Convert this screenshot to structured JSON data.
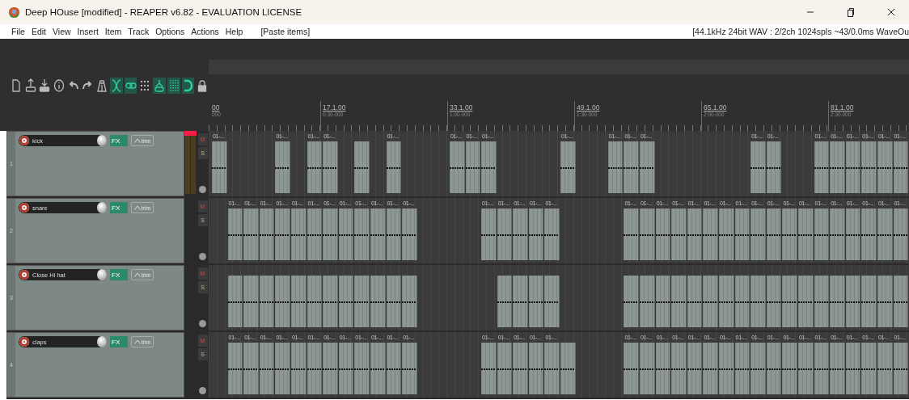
{
  "window": {
    "title": "Deep HOuse [modified] - REAPER v6.82 - EVALUATION LICENSE"
  },
  "menu": [
    {
      "label": "File"
    },
    {
      "label": "Edit"
    },
    {
      "label": "View"
    },
    {
      "label": "Insert"
    },
    {
      "label": "Item"
    },
    {
      "label": "Track"
    },
    {
      "label": "Options"
    },
    {
      "label": "Actions"
    },
    {
      "label": "Help"
    }
  ],
  "last_action": "[Paste items]",
  "audio_status": "[44.1kHz 24bit WAV : 2/2ch 1024spls ~43/0.0ms WaveOu",
  "toolbar": [
    {
      "kind": "new-file",
      "on": false
    },
    {
      "kind": "upload",
      "on": false
    },
    {
      "kind": "download",
      "on": false
    },
    {
      "kind": "info",
      "on": false
    },
    {
      "kind": "undo",
      "on": false
    },
    {
      "kind": "redo",
      "on": false
    },
    {
      "kind": "metronome",
      "on": false
    },
    {
      "kind": "crossfade",
      "on": true
    },
    {
      "kind": "link",
      "on": true
    },
    {
      "kind": "grid-dots",
      "on": false
    },
    {
      "kind": "group",
      "on": true
    },
    {
      "kind": "grid-lines",
      "on": true
    },
    {
      "kind": "magnet",
      "on": true
    },
    {
      "kind": "lock",
      "on": false
    }
  ],
  "ruler": [
    {
      "bar": "00",
      "time": "000"
    },
    {
      "bar": "17.1.00",
      "time": "0:30.000"
    },
    {
      "bar": "33.1.00",
      "time": "1:00.000"
    },
    {
      "bar": "49.1.00",
      "time": "1:30.000"
    },
    {
      "bar": "65.1.00",
      "time": "2:00.000"
    },
    {
      "bar": "81.1.00",
      "time": "2:30.000"
    }
  ],
  "tracks": [
    {
      "number": "1",
      "name": "kick",
      "fx": "FX",
      "trim": "trim",
      "mute": "M",
      "solo": "S",
      "peak": true,
      "items": [
        {
          "kind": "clip",
          "label": "01-..."
        },
        {
          "kind": "gap"
        },
        {
          "kind": "gap"
        },
        {
          "kind": "gap"
        },
        {
          "kind": "clip",
          "label": "01-..."
        },
        {
          "kind": "gap"
        },
        {
          "kind": "clip",
          "label": "01-..."
        },
        {
          "kind": "clip",
          "label": "01-..."
        },
        {
          "kind": "gap"
        },
        {
          "kind": "tail"
        },
        {
          "kind": "gap"
        },
        {
          "kind": "clip",
          "label": "01-..."
        },
        {
          "kind": "gap"
        },
        {
          "kind": "gap"
        },
        {
          "kind": "gap"
        },
        {
          "kind": "clip",
          "label": "01-..."
        },
        {
          "kind": "clip",
          "label": "01-..."
        },
        {
          "kind": "clip",
          "label": "01-..."
        },
        {
          "kind": "gap"
        },
        {
          "kind": "gap"
        },
        {
          "kind": "gap"
        },
        {
          "kind": "gap"
        },
        {
          "kind": "clip",
          "label": "01-..."
        },
        {
          "kind": "gap"
        },
        {
          "kind": "gap"
        },
        {
          "kind": "clip",
          "label": "01-..."
        },
        {
          "kind": "clip",
          "label": "01-..."
        },
        {
          "kind": "clip",
          "label": "01-..."
        },
        {
          "kind": "gap"
        },
        {
          "kind": "gap"
        },
        {
          "kind": "gap"
        },
        {
          "kind": "gap"
        },
        {
          "kind": "gap"
        },
        {
          "kind": "gap"
        },
        {
          "kind": "clip",
          "label": "01-..."
        },
        {
          "kind": "clip",
          "label": "01-..."
        },
        {
          "kind": "gap"
        },
        {
          "kind": "gap"
        },
        {
          "kind": "clip",
          "label": "01-..."
        },
        {
          "kind": "clip",
          "label": "01-..."
        },
        {
          "kind": "clip",
          "label": "01-..."
        },
        {
          "kind": "clip",
          "label": "01-..."
        },
        {
          "kind": "clip",
          "label": "01-..."
        },
        {
          "kind": "clip",
          "label": "01-..."
        }
      ]
    },
    {
      "number": "2",
      "name": "snare",
      "fx": "FX",
      "trim": "trim",
      "mute": "M",
      "solo": "S",
      "peak": false,
      "items": [
        {
          "kind": "gap"
        },
        {
          "kind": "clip",
          "label": "01-..."
        },
        {
          "kind": "clip",
          "label": "01-..."
        },
        {
          "kind": "clip",
          "label": "01-..."
        },
        {
          "kind": "clip",
          "label": "01-..."
        },
        {
          "kind": "clip",
          "label": "01-..."
        },
        {
          "kind": "clip",
          "label": "01-..."
        },
        {
          "kind": "clip",
          "label": "01-..."
        },
        {
          "kind": "clip",
          "label": "01-..."
        },
        {
          "kind": "clip",
          "label": "01-..."
        },
        {
          "kind": "clip",
          "label": "01-..."
        },
        {
          "kind": "clip",
          "label": "01-..."
        },
        {
          "kind": "clip",
          "label": "01-..."
        },
        {
          "kind": "gap"
        },
        {
          "kind": "gap"
        },
        {
          "kind": "gap"
        },
        {
          "kind": "gap"
        },
        {
          "kind": "clip",
          "label": "01-..."
        },
        {
          "kind": "clip",
          "label": "01-..."
        },
        {
          "kind": "clip",
          "label": "01-..."
        },
        {
          "kind": "clip",
          "label": "01-..."
        },
        {
          "kind": "clip",
          "label": "01-..."
        },
        {
          "kind": "gap"
        },
        {
          "kind": "gap"
        },
        {
          "kind": "gap"
        },
        {
          "kind": "gap"
        },
        {
          "kind": "clip",
          "label": "01-..."
        },
        {
          "kind": "clip",
          "label": "01-..."
        },
        {
          "kind": "clip",
          "label": "01-..."
        },
        {
          "kind": "clip",
          "label": "01-..."
        },
        {
          "kind": "clip",
          "label": "01-..."
        },
        {
          "kind": "clip",
          "label": "01-..."
        },
        {
          "kind": "clip",
          "label": "01-..."
        },
        {
          "kind": "clip",
          "label": "01-..."
        },
        {
          "kind": "clip",
          "label": "01-..."
        },
        {
          "kind": "clip",
          "label": "01-..."
        },
        {
          "kind": "clip",
          "label": "01-..."
        },
        {
          "kind": "clip",
          "label": "01-..."
        },
        {
          "kind": "clip",
          "label": "01-..."
        },
        {
          "kind": "clip",
          "label": "01-..."
        },
        {
          "kind": "clip",
          "label": "01-..."
        },
        {
          "kind": "clip",
          "label": "01-..."
        },
        {
          "kind": "clip",
          "label": "01-..."
        },
        {
          "kind": "clip",
          "label": "01-..."
        }
      ]
    },
    {
      "number": "3",
      "name": "Close Hi hat",
      "fx": "FX",
      "trim": "trim",
      "mute": "M",
      "solo": "S",
      "peak": false,
      "items": [
        {
          "kind": "gap"
        },
        {
          "kind": "tail"
        },
        {
          "kind": "tail"
        },
        {
          "kind": "tail"
        },
        {
          "kind": "tail"
        },
        {
          "kind": "tail"
        },
        {
          "kind": "tail"
        },
        {
          "kind": "tail"
        },
        {
          "kind": "tail"
        },
        {
          "kind": "tail"
        },
        {
          "kind": "tail"
        },
        {
          "kind": "tail"
        },
        {
          "kind": "tail"
        },
        {
          "kind": "gap"
        },
        {
          "kind": "gap"
        },
        {
          "kind": "gap"
        },
        {
          "kind": "gap"
        },
        {
          "kind": "gap"
        },
        {
          "kind": "tail"
        },
        {
          "kind": "tail"
        },
        {
          "kind": "tail"
        },
        {
          "kind": "tail"
        },
        {
          "kind": "gap"
        },
        {
          "kind": "gap"
        },
        {
          "kind": "gap"
        },
        {
          "kind": "gap"
        },
        {
          "kind": "tail"
        },
        {
          "kind": "tail"
        },
        {
          "kind": "tail"
        },
        {
          "kind": "tail"
        },
        {
          "kind": "tail"
        },
        {
          "kind": "tail"
        },
        {
          "kind": "tail"
        },
        {
          "kind": "tail"
        },
        {
          "kind": "tail"
        },
        {
          "kind": "tail"
        },
        {
          "kind": "tail"
        },
        {
          "kind": "tail"
        },
        {
          "kind": "tail"
        },
        {
          "kind": "tail"
        },
        {
          "kind": "tail"
        },
        {
          "kind": "tail"
        },
        {
          "kind": "tail"
        },
        {
          "kind": "tail"
        }
      ]
    },
    {
      "number": "4",
      "name": "claps",
      "fx": "FX",
      "trim": "trim",
      "mute": "M",
      "solo": "S",
      "peak": false,
      "items": [
        {
          "kind": "gap"
        },
        {
          "kind": "clip",
          "label": "01-..."
        },
        {
          "kind": "clip",
          "label": "01-..."
        },
        {
          "kind": "clip",
          "label": "01-..."
        },
        {
          "kind": "clip",
          "label": "01-..."
        },
        {
          "kind": "clip",
          "label": "01-..."
        },
        {
          "kind": "clip",
          "label": "01-..."
        },
        {
          "kind": "clip",
          "label": "01-..."
        },
        {
          "kind": "clip",
          "label": "01-..."
        },
        {
          "kind": "clip",
          "label": "01-..."
        },
        {
          "kind": "clip",
          "label": "01-..."
        },
        {
          "kind": "clip",
          "label": "01-..."
        },
        {
          "kind": "clip",
          "label": "01-..."
        },
        {
          "kind": "gap"
        },
        {
          "kind": "gap"
        },
        {
          "kind": "gap"
        },
        {
          "kind": "gap"
        },
        {
          "kind": "clip",
          "label": "01-..."
        },
        {
          "kind": "clip",
          "label": "01-..."
        },
        {
          "kind": "clip",
          "label": "01-..."
        },
        {
          "kind": "clip",
          "label": "01-..."
        },
        {
          "kind": "clip",
          "label": "01-..."
        },
        {
          "kind": "tail"
        },
        {
          "kind": "gap"
        },
        {
          "kind": "gap"
        },
        {
          "kind": "gap"
        },
        {
          "kind": "clip",
          "label": "01-..."
        },
        {
          "kind": "clip",
          "label": "01-..."
        },
        {
          "kind": "clip",
          "label": "01-..."
        },
        {
          "kind": "clip",
          "label": "01-..."
        },
        {
          "kind": "clip",
          "label": "01-..."
        },
        {
          "kind": "clip",
          "label": "01-..."
        },
        {
          "kind": "clip",
          "label": "01-..."
        },
        {
          "kind": "clip",
          "label": "01-..."
        },
        {
          "kind": "clip",
          "label": "01-..."
        },
        {
          "kind": "clip",
          "label": "01-..."
        },
        {
          "kind": "clip",
          "label": "01-..."
        },
        {
          "kind": "clip",
          "label": "01-..."
        },
        {
          "kind": "clip",
          "label": "01-..."
        },
        {
          "kind": "clip",
          "label": "01-..."
        },
        {
          "kind": "clip",
          "label": "01-..."
        },
        {
          "kind": "clip",
          "label": "01-..."
        },
        {
          "kind": "clip",
          "label": "01-..."
        },
        {
          "kind": "clip",
          "label": "01-..."
        }
      ]
    }
  ]
}
